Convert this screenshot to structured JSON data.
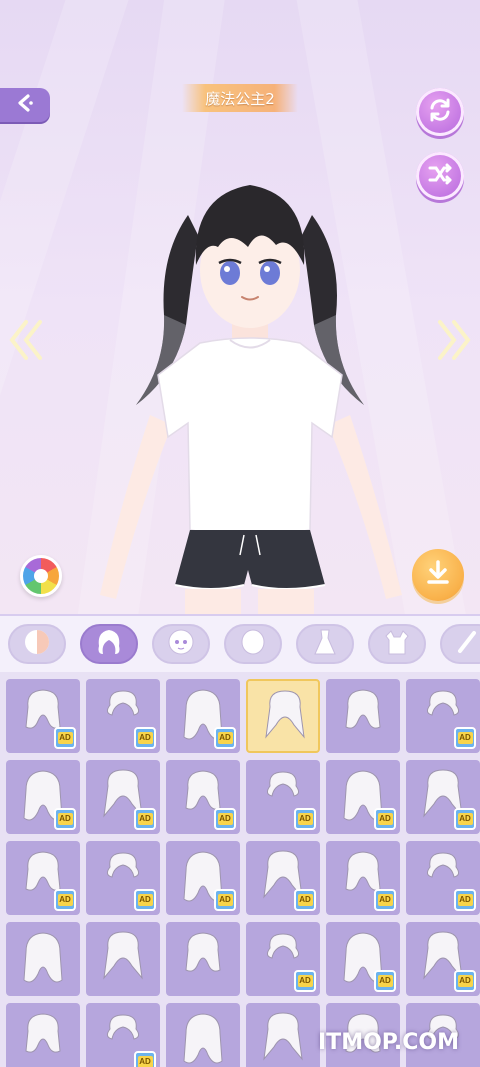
{
  "header": {
    "title": "魔法公主2"
  },
  "colors": {
    "accent": "#9b79d4",
    "download": "#f9b14a",
    "panel": "#b6a6dd",
    "selected": "#f9e3a7"
  },
  "icons": {
    "back": "back-arrow-icon",
    "reset": "refresh-icon",
    "random": "shuffle-icon",
    "prev": "chevron-double-left-icon",
    "next": "chevron-double-right-icon",
    "palette": "color-wheel-icon",
    "download": "download-icon"
  },
  "tabs": [
    {
      "name": "skin",
      "icon": "skin-tone-icon",
      "active": false
    },
    {
      "name": "hair",
      "icon": "hair-icon",
      "active": true
    },
    {
      "name": "face",
      "icon": "face-icon",
      "active": false
    },
    {
      "name": "head",
      "icon": "head-icon",
      "active": false
    },
    {
      "name": "dress",
      "icon": "dress-icon",
      "active": false
    },
    {
      "name": "top",
      "icon": "top-icon",
      "active": false
    },
    {
      "name": "more",
      "icon": "more-icon",
      "active": false
    }
  ],
  "items": [
    {
      "ad": true,
      "selected": false
    },
    {
      "ad": true,
      "selected": false
    },
    {
      "ad": true,
      "selected": false
    },
    {
      "ad": false,
      "selected": true
    },
    {
      "ad": false,
      "selected": false
    },
    {
      "ad": true,
      "selected": false
    },
    {
      "ad": true,
      "selected": false
    },
    {
      "ad": true,
      "selected": false
    },
    {
      "ad": true,
      "selected": false
    },
    {
      "ad": true,
      "selected": false
    },
    {
      "ad": true,
      "selected": false
    },
    {
      "ad": true,
      "selected": false
    },
    {
      "ad": true,
      "selected": false
    },
    {
      "ad": true,
      "selected": false
    },
    {
      "ad": true,
      "selected": false
    },
    {
      "ad": true,
      "selected": false
    },
    {
      "ad": true,
      "selected": false
    },
    {
      "ad": true,
      "selected": false
    },
    {
      "ad": false,
      "selected": false
    },
    {
      "ad": false,
      "selected": false
    },
    {
      "ad": false,
      "selected": false
    },
    {
      "ad": true,
      "selected": false
    },
    {
      "ad": true,
      "selected": false
    },
    {
      "ad": true,
      "selected": false
    },
    {
      "ad": false,
      "selected": false
    },
    {
      "ad": true,
      "selected": false
    },
    {
      "ad": false,
      "selected": false
    },
    {
      "ad": false,
      "selected": false
    },
    {
      "ad": false,
      "selected": false
    },
    {
      "ad": false,
      "selected": false
    }
  ],
  "ad_label": "AD",
  "watermark": "ITMOP.COM"
}
